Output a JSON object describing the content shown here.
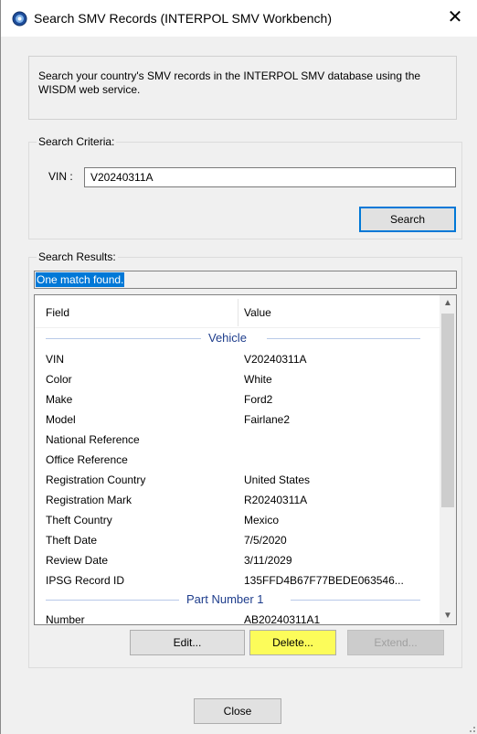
{
  "window": {
    "title": "Search SMV Records (INTERPOL SMV Workbench)",
    "close_glyph": "✕"
  },
  "info": {
    "text": "Search your country's SMV records in the INTERPOL SMV database using the WISDM web service."
  },
  "criteria": {
    "legend": "Search Criteria:",
    "vin_label": "VIN :",
    "vin_value": "V20240311A",
    "search_label": "Search"
  },
  "results": {
    "legend": "Search Results:",
    "status": "One match found.",
    "columns": [
      "Field",
      "Value"
    ],
    "groups": [
      {
        "label": "Vehicle"
      },
      {
        "label": "Part Number 1"
      }
    ],
    "rows": [
      {
        "field": "VIN",
        "value": "V20240311A"
      },
      {
        "field": "Color",
        "value": "White"
      },
      {
        "field": "Make",
        "value": "Ford2"
      },
      {
        "field": "Model",
        "value": "Fairlane2"
      },
      {
        "field": "National Reference",
        "value": ""
      },
      {
        "field": "Office Reference",
        "value": ""
      },
      {
        "field": "Registration Country",
        "value": "United States"
      },
      {
        "field": "Registration Mark",
        "value": "R20240311A"
      },
      {
        "field": "Theft Country",
        "value": "Mexico"
      },
      {
        "field": "Theft Date",
        "value": "7/5/2020"
      },
      {
        "field": "Review Date",
        "value": "3/11/2029"
      },
      {
        "field": "IPSG Record ID",
        "value": "135FFD4B67F77BEDE063546..."
      }
    ],
    "part_rows": [
      {
        "field": "Number",
        "value": "AB20240311A1"
      }
    ]
  },
  "actions": {
    "edit_label": "Edit...",
    "delete_label": "Delete...",
    "extend_label": "Extend...",
    "close_label": "Close"
  },
  "colors": {
    "selection": "#0078d7",
    "group_text": "#1e3d8c",
    "highlight": "#fcfc5a"
  },
  "icons": {
    "app": "interpol-globe-icon",
    "close": "close-icon",
    "scroll_up": "chevron-up-icon",
    "scroll_down": "chevron-down-icon"
  }
}
